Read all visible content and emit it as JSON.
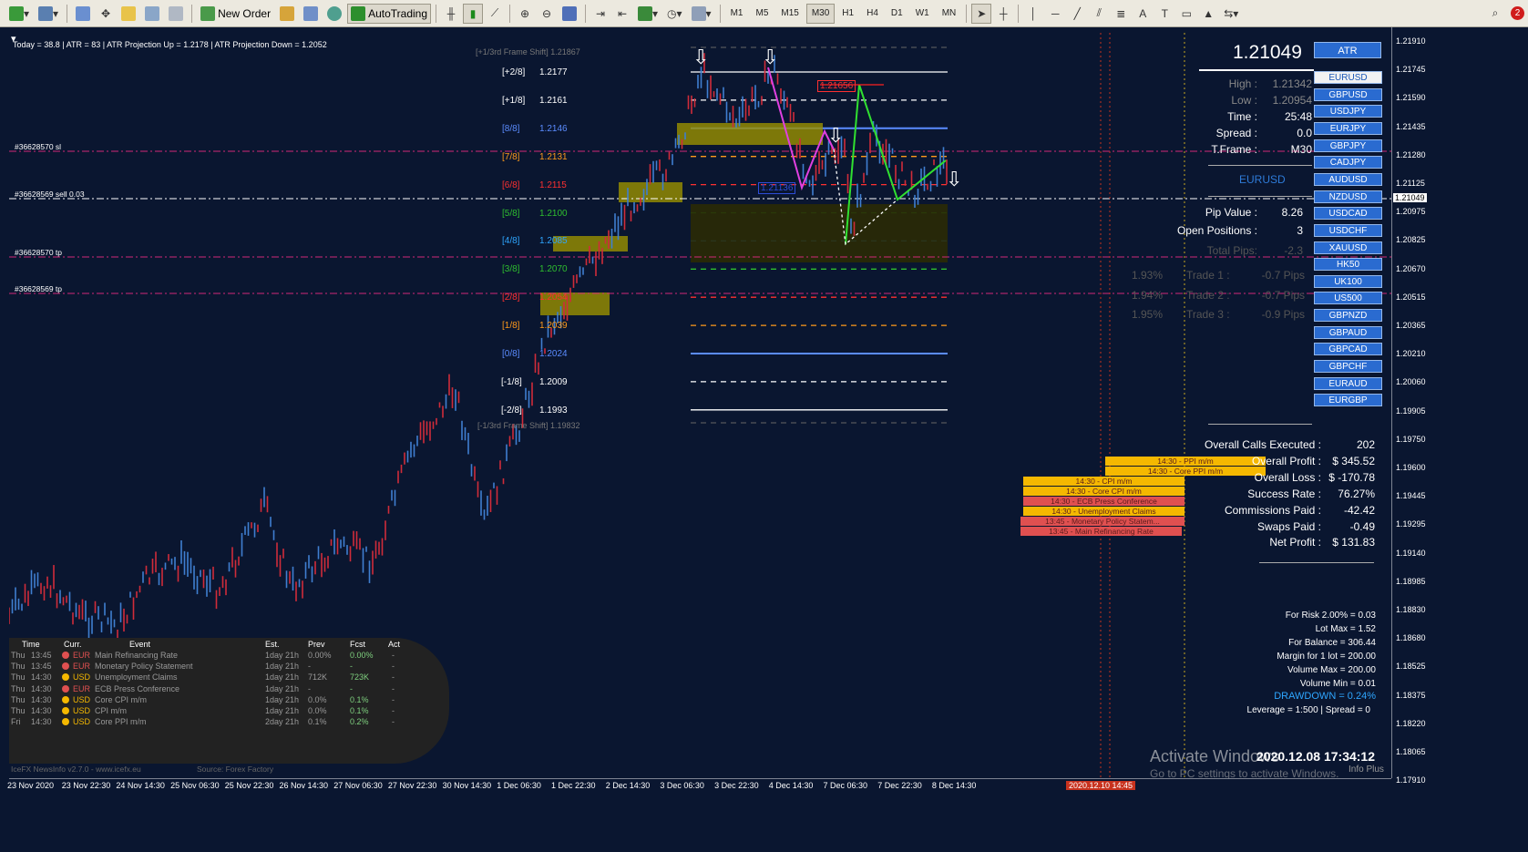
{
  "toolbar": {
    "new_order": "New Order",
    "autotrading": "AutoTrading",
    "timeframes": [
      "M1",
      "M5",
      "M15",
      "M30",
      "H1",
      "H4",
      "D1",
      "W1",
      "MN"
    ],
    "active_timeframe": "M30",
    "notification_count": "2"
  },
  "info_line": "Today = 38.8   |   ATR = 83   |   ATR Projection Up = 1.2178   |   ATR Projection Down = 1.2052",
  "orders": [
    {
      "text": "#36628570 sl"
    },
    {
      "text": "#36628569 sell 0.03"
    },
    {
      "text": "#36628570 tp"
    },
    {
      "text": "#36628569 tp"
    }
  ],
  "murrey": {
    "frame_shift_up": "[+1/3rd Frame Shift]  1.21867",
    "frame_shift_down": "[-1/3rd Frame Shift]  1.19832",
    "levels": [
      {
        "tag": "[+2/8]",
        "price": "1.2177",
        "color": "#ffffff"
      },
      {
        "tag": "[+1/8]",
        "price": "1.2161",
        "color": "#ffffff"
      },
      {
        "tag": "[8/8]",
        "price": "1.2146",
        "color": "#5b8cff"
      },
      {
        "tag": "[7/8]",
        "price": "1.2131",
        "color": "#ff9a1a"
      },
      {
        "tag": "[6/8]",
        "price": "1.2115",
        "color": "#ff3030"
      },
      {
        "tag": "[5/8]",
        "price": "1.2100",
        "color": "#2fbf2f"
      },
      {
        "tag": "[4/8]",
        "price": "1.2085",
        "color": "#2ea6ff"
      },
      {
        "tag": "[3/8]",
        "price": "1.2070",
        "color": "#2fbf2f"
      },
      {
        "tag": "[2/8]",
        "price": "1.2054",
        "color": "#ff3030"
      },
      {
        "tag": "[1/8]",
        "price": "1.2039",
        "color": "#ff9a1a"
      },
      {
        "tag": "[0/8]",
        "price": "1.2024",
        "color": "#5b8cff"
      },
      {
        "tag": "[-1/8]",
        "price": "1.2009",
        "color": "#ffffff"
      },
      {
        "tag": "[-2/8]",
        "price": "1.1993",
        "color": "#ffffff"
      }
    ]
  },
  "pattern_labels": {
    "upper": "1.21656",
    "lower": "1.21136"
  },
  "dashboard": {
    "atr_button": "ATR",
    "price": "1.21049",
    "high_label": "High :",
    "high": "1.21342",
    "low_label": "Low :",
    "low": "1.20954",
    "time_label": "Time :",
    "time": "25:48",
    "spread_label": "Spread :",
    "spread": "0.0",
    "tframe_label": "T.Frame :",
    "tframe": "M30",
    "symbol": "EURUSD",
    "pip_value_label": "Pip Value :",
    "pip_value": "8.26",
    "open_positions_label": "Open Positions :",
    "open_positions": "3",
    "total_pips_label": "Total Pips:",
    "total_pips": "-2.3",
    "trades": [
      {
        "pct": "1.93%",
        "label": "Trade 1 :",
        "pips": "-0.7 Pips"
      },
      {
        "pct": "1.94%",
        "label": "Trade 2 :",
        "pips": "-0.7 Pips"
      },
      {
        "pct": "1.95%",
        "label": "Trade 3 :",
        "pips": "-0.9 Pips"
      }
    ],
    "symbols": [
      "EURUSD",
      "GBPUSD",
      "USDJPY",
      "EURJPY",
      "GBPJPY",
      "CADJPY",
      "AUDUSD",
      "NZDUSD",
      "USDCAD",
      "USDCHF",
      "XAUUSD",
      "HK50",
      "UK100",
      "US500",
      "GBPNZD",
      "GBPAUD",
      "GBPCAD",
      "GBPCHF",
      "EURAUD",
      "EURGBP"
    ],
    "stats": [
      {
        "label": "Overall Calls Executed :",
        "value": "202"
      },
      {
        "label": "Overall Profit :",
        "value": "$ 345.52"
      },
      {
        "label": "Overall Loss :",
        "value": "$ -170.78"
      },
      {
        "label": "Success Rate :",
        "value": "76.27%"
      },
      {
        "label": "Commissions Paid :",
        "value": "-42.42"
      },
      {
        "label": "Swaps Paid :",
        "value": "-0.49"
      },
      {
        "label": "Net Profit :",
        "value": "$ 131.83"
      }
    ],
    "risk_lines": [
      "For Risk 2.00% = 0.03",
      "Lot Max = 1.52",
      "For Balance = 306.44",
      "Margin for 1 lot = 200.00",
      "Volume Max = 200.00",
      "Volume Min = 0.01"
    ],
    "drawdown": "DRAWDOWN =  0.24%",
    "leverage": "Leverage = 1:500 | Spread = 0"
  },
  "news_bars": [
    {
      "text": "14:30 - PPI m/m",
      "color": "#f5b800"
    },
    {
      "text": "14:30 - Core PPI m/m",
      "color": "#f5b800"
    },
    {
      "text": "14:30 - CPI m/m",
      "color": "#f5b800"
    },
    {
      "text": "14:30 - Core CPI m/m",
      "color": "#f5b800"
    },
    {
      "text": "14:30 - ECB Press Conference",
      "color": "#e05050"
    },
    {
      "text": "14:30 - Unemployment Claims",
      "color": "#f5b800"
    },
    {
      "text": "13:45 - Monetary Policy Statem...",
      "color": "#e05050"
    },
    {
      "text": "13:45 - Main Refinancing Rate",
      "color": "#e05050"
    }
  ],
  "news_panel": {
    "headers": [
      "Time",
      "Curr.",
      "Event",
      "Est.",
      "Prev",
      "Fcst",
      "Act"
    ],
    "rows": [
      {
        "day": "Thu",
        "time": "13:45",
        "cur": "EUR",
        "dot": "#e05050",
        "event": "Main Refinancing Rate",
        "est": "1day 21h",
        "prev": "0.00%",
        "fcst": "0.00%",
        "act": "-"
      },
      {
        "day": "Thu",
        "time": "13:45",
        "cur": "EUR",
        "dot": "#e05050",
        "event": "Monetary Policy Statement",
        "est": "1day 21h",
        "prev": "-",
        "fcst": "-",
        "act": "-"
      },
      {
        "day": "Thu",
        "time": "14:30",
        "cur": "USD",
        "dot": "#f5b800",
        "event": "Unemployment Claims",
        "est": "1day 21h",
        "prev": "712K",
        "fcst": "723K",
        "act": "-"
      },
      {
        "day": "Thu",
        "time": "14:30",
        "cur": "EUR",
        "dot": "#e05050",
        "event": "ECB Press Conference",
        "est": "1day 21h",
        "prev": "-",
        "fcst": "-",
        "act": "-"
      },
      {
        "day": "Thu",
        "time": "14:30",
        "cur": "USD",
        "dot": "#f5b800",
        "event": "Core CPI m/m",
        "est": "1day 21h",
        "prev": "0.0%",
        "fcst": "0.1%",
        "act": "-"
      },
      {
        "day": "Thu",
        "time": "14:30",
        "cur": "USD",
        "dot": "#f5b800",
        "event": "CPI m/m",
        "est": "1day 21h",
        "prev": "0.0%",
        "fcst": "0.1%",
        "act": "-"
      },
      {
        "day": "Fri",
        "time": "14:30",
        "cur": "USD",
        "dot": "#f5b800",
        "event": "Core PPI m/m",
        "est": "2day 21h",
        "prev": "0.1%",
        "fcst": "0.2%",
        "act": "-"
      }
    ],
    "footer_left": "IceFX NewsInfo v2.7.0  -  www.icefx.eu",
    "footer_right": "Source: Forex Factory"
  },
  "price_ticks": [
    "1.21910",
    "1.21745",
    "1.21590",
    "1.21435",
    "1.21280",
    "1.21125",
    "1.20975",
    "1.20825",
    "1.20670",
    "1.20515",
    "1.20365",
    "1.20210",
    "1.20060",
    "1.19905",
    "1.19750",
    "1.19600",
    "1.19445",
    "1.19295",
    "1.19140",
    "1.18985",
    "1.18830",
    "1.18680",
    "1.18525",
    "1.18375",
    "1.18220",
    "1.18065",
    "1.17910"
  ],
  "current_price_tag": "1.21049",
  "time_ticks": [
    "23 Nov 2020",
    "23 Nov 22:30",
    "24 Nov 14:30",
    "25 Nov 06:30",
    "25 Nov 22:30",
    "26 Nov 14:30",
    "27 Nov 06:30",
    "27 Nov 22:30",
    "30 Nov 14:30",
    "1 Dec 06:30",
    "1 Dec 22:30",
    "2 Dec 14:30",
    "3 Dec 06:30",
    "3 Dec 22:30",
    "4 Dec 14:30",
    "7 Dec 06:30",
    "7 Dec 22:30",
    "8 Dec 14:30"
  ],
  "future_date_tag": "2020.12.10 14:45",
  "watermark_title": "Activate Windows",
  "watermark_sub": "Go to PC settings to activate Windows.",
  "clock": "2020.12.08 17:34:12",
  "info_plus": "Info Plus"
}
